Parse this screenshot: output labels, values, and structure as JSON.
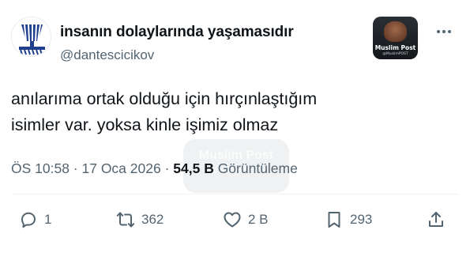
{
  "author": {
    "display_name": "insanın dolaylarında yaşamasıdır",
    "handle": "@dantescicikov",
    "avatar_icon": "blue-white-striped-cup-avatar"
  },
  "source_logo": {
    "title": "Muslim Post",
    "subtitle": "@MuslimPOST",
    "icon": "portrait-logo"
  },
  "tweet": {
    "lines": [
      "anılarıma ortak olduğu için hırçınlaştığım",
      "isimler var. yoksa kinle işimiz olmaz"
    ]
  },
  "watermark": {
    "title": "Muslim Post",
    "subtitle": "@MuslimPOST"
  },
  "meta": {
    "timestamp": "ÖS 10:58 · 17 Oca 2026 · ",
    "views_count": "54,5 B",
    "views_label": " Görüntüleme"
  },
  "actions": {
    "replies": "1",
    "retweets": "362",
    "likes": "2 B",
    "bookmarks": "293"
  },
  "colors": {
    "text": "#0f1419",
    "secondary": "#536471",
    "divider": "#eff3f4"
  }
}
